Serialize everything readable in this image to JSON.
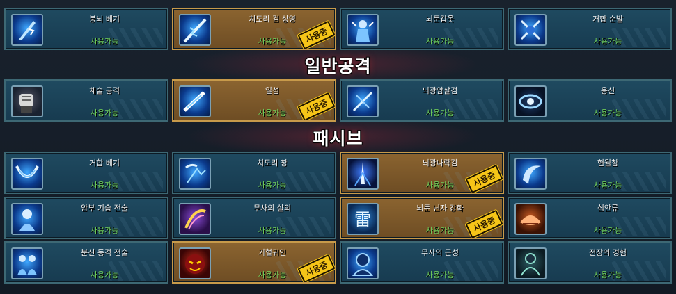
{
  "sections": [
    {
      "title": ""
    },
    {
      "title": "일반공격"
    },
    {
      "title": "패시브"
    }
  ],
  "badge_label": "사용중",
  "status_label": "사용가능",
  "colors": {
    "card_normal_border": "#3d6874",
    "card_in_use_border": "#c79a4a",
    "status_green": "#6fcf5a",
    "badge_yellow": "#f5c518"
  },
  "rows": [
    [
      {
        "name": "붕뇌 베기",
        "in_use": false,
        "icon": "lightning-blade-icon"
      },
      {
        "name": "치도리 검 상영",
        "in_use": true,
        "icon": "lightning-sword-icon"
      },
      {
        "name": "뇌둔갑옷",
        "in_use": false,
        "icon": "lightning-armor-icon"
      },
      {
        "name": "거합 순발",
        "in_use": false,
        "icon": "quick-draw-icon"
      }
    ],
    [
      {
        "name": "체술 공격",
        "in_use": false,
        "icon": "fist-icon"
      },
      {
        "name": "일섬",
        "in_use": true,
        "icon": "flash-slash-icon"
      },
      {
        "name": "뇌광암살검",
        "in_use": false,
        "icon": "lightning-assassin-icon"
      },
      {
        "name": "응신",
        "in_use": false,
        "icon": "eye-icon"
      }
    ],
    [
      {
        "name": "거합 베기",
        "in_use": false,
        "icon": "draw-slash-icon"
      },
      {
        "name": "치도리 창",
        "in_use": false,
        "icon": "lightning-spear-icon"
      },
      {
        "name": "뇌광나락검",
        "in_use": true,
        "icon": "abyss-sword-icon"
      },
      {
        "name": "현월참",
        "in_use": false,
        "icon": "crescent-moon-icon"
      }
    ],
    [
      {
        "name": "암부 기습 전술",
        "in_use": false,
        "icon": "ambush-icon"
      },
      {
        "name": "무사의 살의",
        "in_use": false,
        "icon": "killing-intent-icon"
      },
      {
        "name": "뇌둔 닌자 강화",
        "in_use": true,
        "icon": "thunder-rune-icon"
      },
      {
        "name": "심안류",
        "in_use": false,
        "icon": "inner-eye-style-icon"
      }
    ],
    [
      {
        "name": "분신 동격 전술",
        "in_use": false,
        "icon": "clone-icon"
      },
      {
        "name": "기혈귀인",
        "in_use": true,
        "icon": "demon-face-icon"
      },
      {
        "name": "무사의 근성",
        "in_use": false,
        "icon": "warrior-spirit-icon"
      },
      {
        "name": "전장의 경험",
        "in_use": false,
        "icon": "battlefield-experience-icon"
      }
    ]
  ]
}
